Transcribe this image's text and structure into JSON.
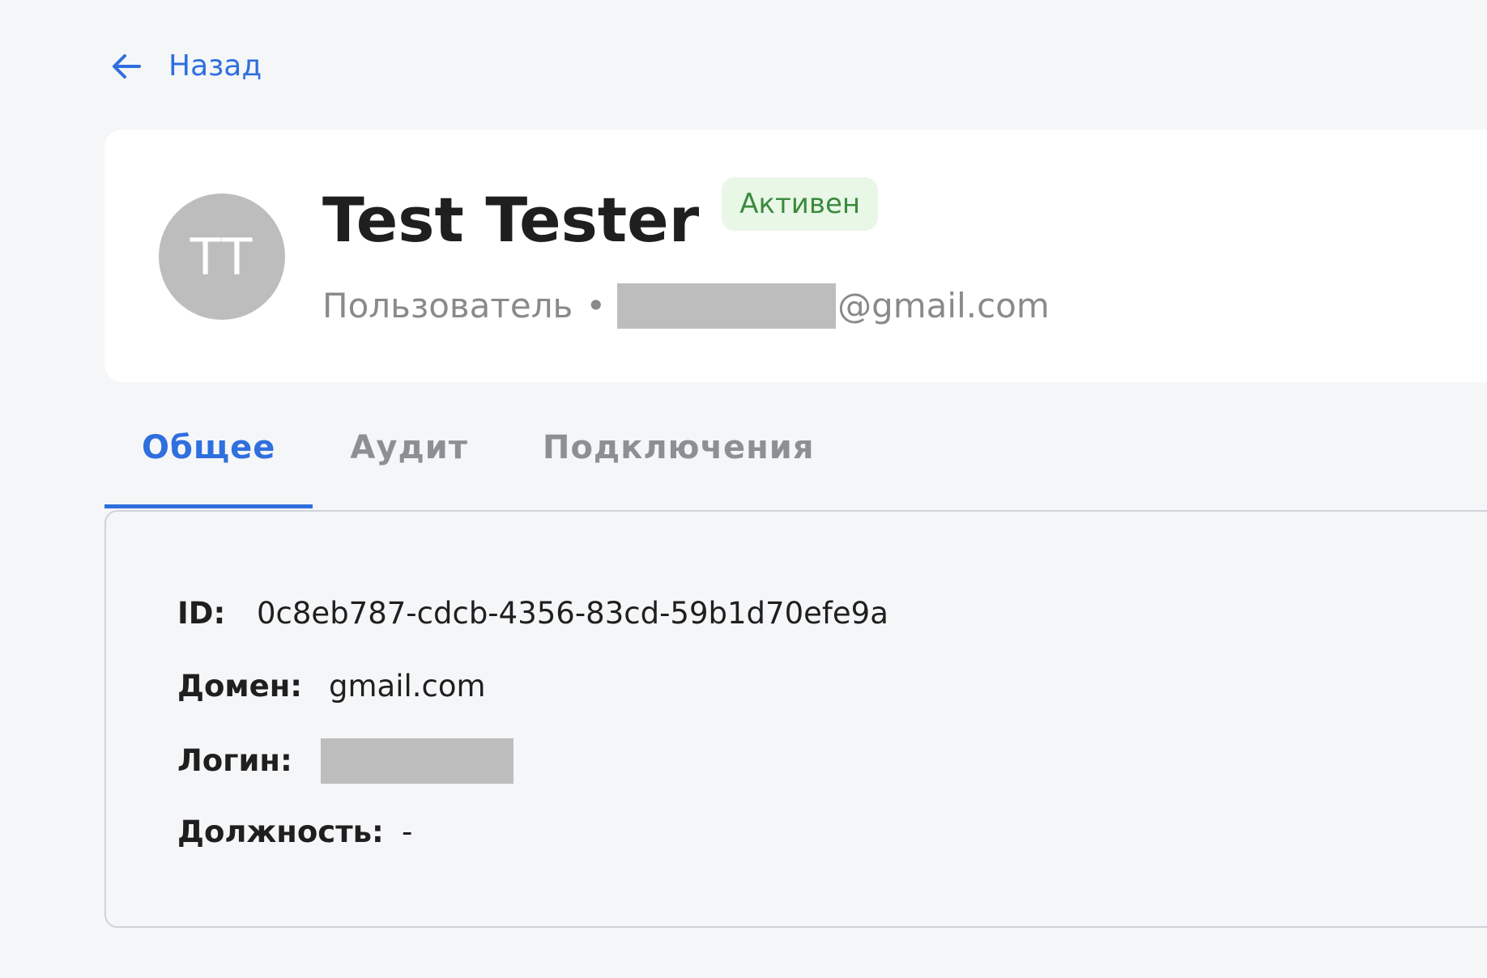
{
  "nav": {
    "back_label": "Назад"
  },
  "profile": {
    "initials": "TT",
    "name": "Test Tester",
    "status": "Активен",
    "role": "Пользователь",
    "separator": "•",
    "email_suffix": "@gmail.com"
  },
  "tabs": [
    {
      "label": "Общее",
      "active": true
    },
    {
      "label": "Аудит",
      "active": false
    },
    {
      "label": "Подключения",
      "active": false
    }
  ],
  "details": {
    "id": {
      "label": "ID:",
      "value": "0c8eb787-cdcb-4356-83cd-59b1d70efe9a"
    },
    "domain": {
      "label": "Домен:",
      "value": "gmail.com"
    },
    "login": {
      "label": "Логин:"
    },
    "position": {
      "label": "Должность:",
      "value": "-"
    }
  },
  "colors": {
    "accent": "#2f6fde",
    "background": "#f5f6f8",
    "card": "#ffffff",
    "avatar": "#bdbdbd",
    "status_bg": "#e8f7e6",
    "status_text": "#3b8a3e",
    "muted_text": "#8a8a8a",
    "redaction": "#bdbdbd"
  },
  "icons": {
    "back": "arrow-left-icon"
  }
}
